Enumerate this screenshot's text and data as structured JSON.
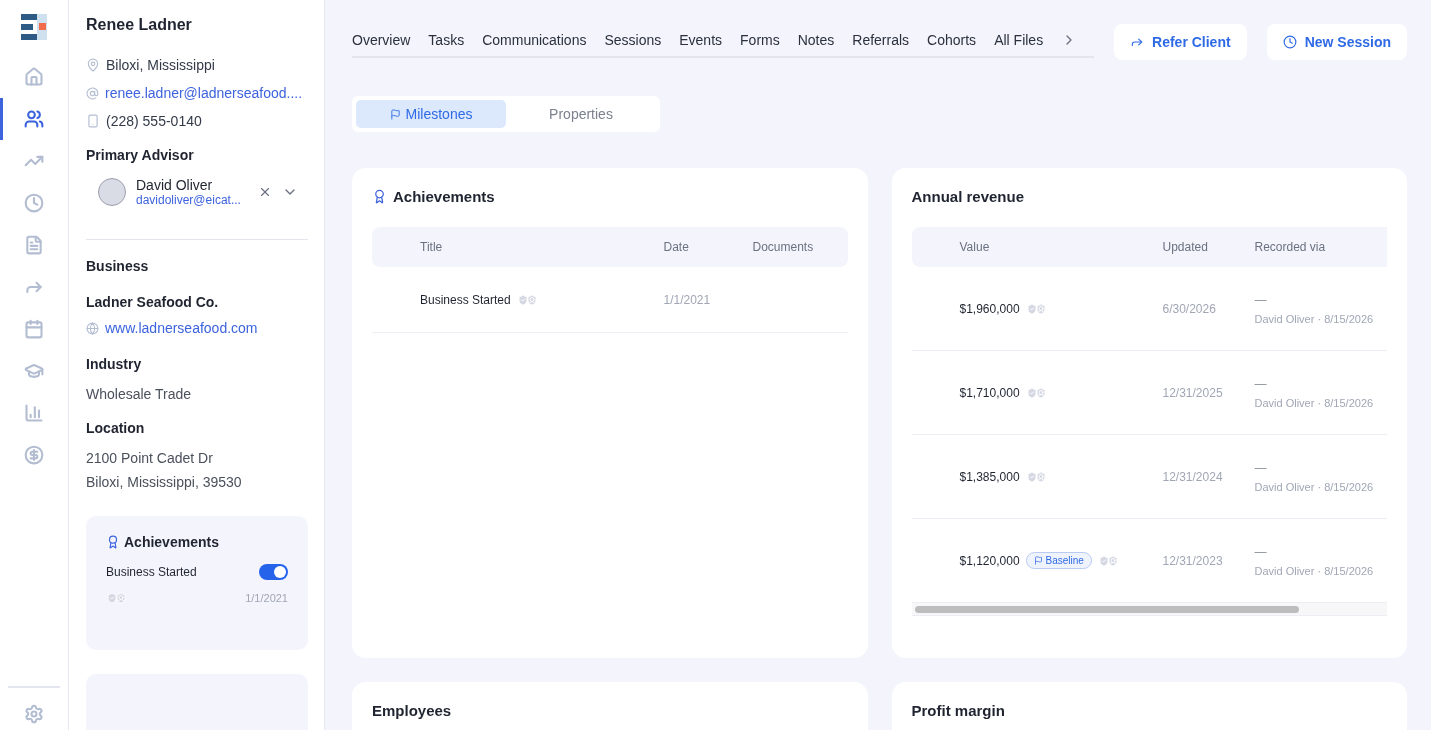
{
  "nav_items": [
    {
      "selected": false
    },
    {
      "selected": true
    },
    {
      "selected": false
    },
    {
      "selected": false
    },
    {
      "selected": false
    },
    {
      "selected": false
    },
    {
      "selected": false
    },
    {
      "selected": false
    },
    {
      "selected": false
    },
    {
      "selected": false
    }
  ],
  "profile": {
    "name": "Renee Ladner",
    "location": "Biloxi, Mississippi",
    "email": "renee.ladner@ladnerseafood....",
    "phone": "(228) 555-0140",
    "advisor_heading": "Primary Advisor",
    "advisor": {
      "name": "David Oliver",
      "email": "davidoliver@eicat..."
    },
    "business_heading": "Business",
    "business_name": "Ladner Seafood Co.",
    "website": "www.ladnerseafood.com",
    "fields": [
      {
        "label": "Industry",
        "lines": [
          "Wholesale Trade"
        ]
      },
      {
        "label": "Location",
        "lines": [
          "2100 Point Cadet Dr",
          "Biloxi, Mississippi, 39530"
        ]
      }
    ],
    "achievements_card": {
      "title": "Achievements",
      "items": [
        {
          "title": "Business Started",
          "on": true,
          "date": "1/1/2021"
        }
      ]
    }
  },
  "tabs": [
    "Overview",
    "Tasks",
    "Communications",
    "Sessions",
    "Events",
    "Forms",
    "Notes",
    "Referrals",
    "Cohorts",
    "All Files"
  ],
  "actions": [
    {
      "kind": "refer",
      "label": "Refer Client"
    },
    {
      "kind": "session",
      "label": "New Session"
    }
  ],
  "segments": [
    {
      "label": "Milestones",
      "selected": true
    },
    {
      "label": "Properties",
      "selected": false
    }
  ],
  "achievements": {
    "title": "Achievements",
    "columns": [
      "Title",
      "Date",
      "Documents"
    ],
    "rows": [
      {
        "title": "Business Started",
        "date": "1/1/2021"
      }
    ]
  },
  "revenue": {
    "title": "Annual revenue",
    "columns": [
      "Value",
      "Updated",
      "Recorded via"
    ],
    "rows": [
      {
        "value": "$1,960,000",
        "updated": "6/30/2026",
        "via": "—",
        "recorded": "David Oliver · 8/15/2026"
      },
      {
        "value": "$1,710,000",
        "updated": "12/31/2025",
        "via": "—",
        "recorded": "David Oliver · 8/15/2026"
      },
      {
        "value": "$1,385,000",
        "updated": "12/31/2024",
        "via": "—",
        "recorded": "David Oliver · 8/15/2026"
      },
      {
        "value": "$1,120,000",
        "tag": "Baseline",
        "updated": "12/31/2023",
        "via": "—",
        "recorded": "David Oliver · 8/15/2026"
      }
    ]
  },
  "more_cards": [
    "Employees",
    "Profit margin"
  ]
}
